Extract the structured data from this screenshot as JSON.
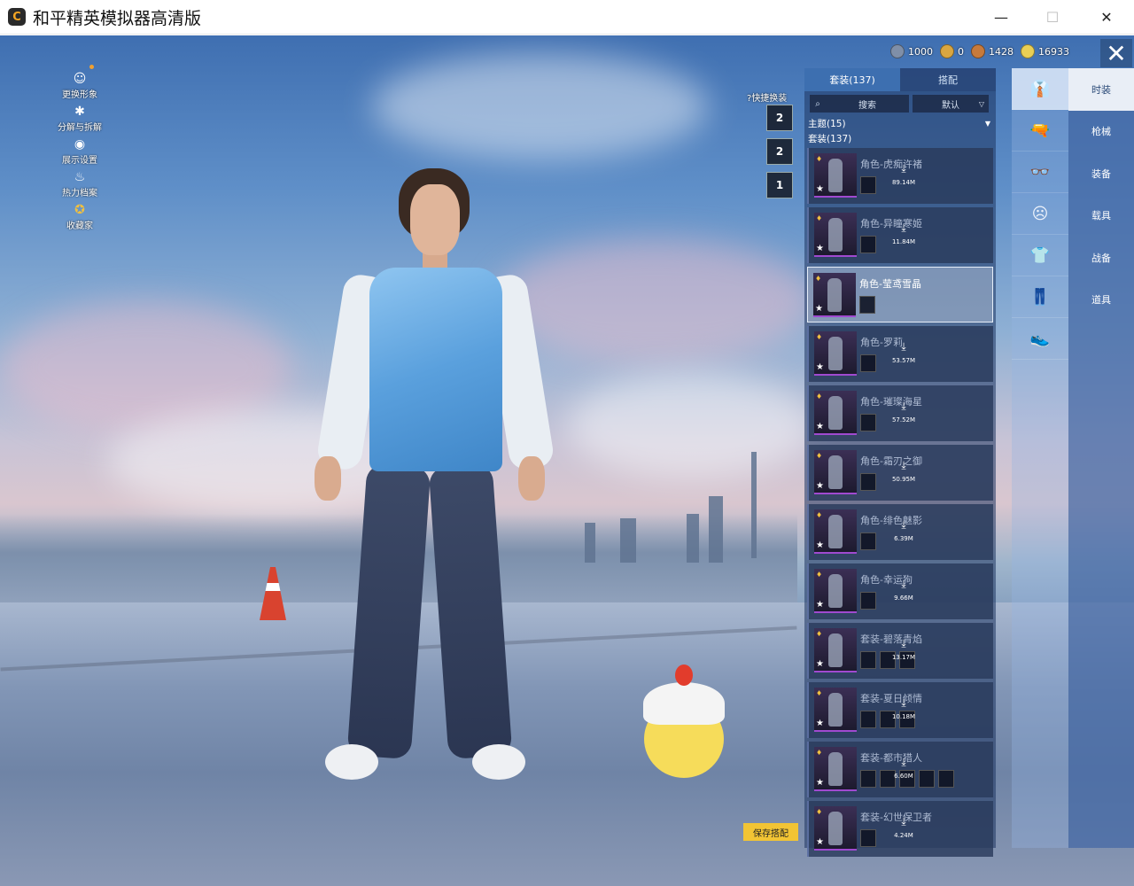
{
  "window": {
    "title": "和平精英模拟器高清版",
    "minimize_glyph": "—",
    "maximize_glyph": "☐",
    "close_glyph": "✕"
  },
  "left_menu": [
    {
      "label": "更换形象",
      "icon": "avatar-icon",
      "glyph": "☺"
    },
    {
      "label": "分解与拆解",
      "icon": "puzzle-icon",
      "glyph": "✱"
    },
    {
      "label": "展示设置",
      "icon": "eye-icon",
      "glyph": "◉"
    },
    {
      "label": "热力档案",
      "icon": "flame-icon",
      "glyph": "♨"
    },
    {
      "label": "收藏家",
      "icon": "collector-badge-icon",
      "glyph": "✪"
    }
  ],
  "currencies": [
    {
      "value": "1000",
      "color": "#7f8fa8"
    },
    {
      "value": "0",
      "color": "#d9a640"
    },
    {
      "value": "1428",
      "color": "#c67a3c"
    },
    {
      "value": "16933",
      "color": "#e9cf55"
    }
  ],
  "close_glyph": "✕",
  "quick_change": {
    "label": "快捷换装",
    "help_glyph": "?",
    "slots": [
      "2",
      "2",
      "1"
    ]
  },
  "wardrobe": {
    "tabs": [
      {
        "label": "套装(137)",
        "active": true
      },
      {
        "label": "搭配",
        "active": false
      }
    ],
    "search_placeholder": "搜索",
    "search_glyph": "⌕",
    "sort": "默认",
    "sort_chev": "▽",
    "section_theme": "主题(15)",
    "section_theme_arrow": "▼",
    "section_suits": "套装(137)",
    "items": [
      {
        "name": "角色-虎痴许褚",
        "size": "89.14M",
        "download": true,
        "selected": false,
        "subs": 1
      },
      {
        "name": "角色-异瞳寒姬",
        "size": "11.84M",
        "download": true,
        "selected": false,
        "subs": 1
      },
      {
        "name": "角色-莹鸢雪晶",
        "size": "",
        "download": false,
        "selected": true,
        "subs": 1
      },
      {
        "name": "角色-罗莉",
        "size": "53.57M",
        "download": true,
        "selected": false,
        "subs": 1
      },
      {
        "name": "角色-璀璨海星",
        "size": "57.52M",
        "download": true,
        "selected": false,
        "subs": 1
      },
      {
        "name": "角色-霜刃之御",
        "size": "50.95M",
        "download": true,
        "selected": false,
        "subs": 1
      },
      {
        "name": "角色-绯色魅影",
        "size": "6.39M",
        "download": true,
        "selected": false,
        "subs": 1
      },
      {
        "name": "角色-幸运狗",
        "size": "9.66M",
        "download": true,
        "selected": false,
        "subs": 1
      },
      {
        "name": "套装-碧落青焰",
        "size": "13.17M",
        "download": true,
        "selected": false,
        "subs": 3
      },
      {
        "name": "套装-夏日倾情",
        "size": "10.18M",
        "download": true,
        "selected": false,
        "subs": 3
      },
      {
        "name": "套装-都市猎人",
        "size": "6.60M",
        "download": true,
        "selected": false,
        "subs": 5
      },
      {
        "name": "套装-幻世保卫者",
        "size": "4.24M",
        "download": true,
        "selected": false,
        "subs": 1
      }
    ],
    "download_glyph": "⤓",
    "star_glyph": "★",
    "badge_glyph": "♦"
  },
  "save_button": "保存搭配",
  "categories": [
    {
      "label": "时装",
      "icon": "outfit-icon",
      "glyph": "👔",
      "active": true
    },
    {
      "label": "枪械",
      "icon": "gun-icon",
      "glyph": "🔫",
      "active": false
    },
    {
      "label": "装备",
      "icon": "goggles-icon",
      "glyph": "👓",
      "active": false
    },
    {
      "label": "载具",
      "icon": "mask-icon",
      "glyph": "☹",
      "active": false
    },
    {
      "label": "战备",
      "icon": "shirt-icon",
      "glyph": "👕",
      "active": false
    },
    {
      "label": "道具",
      "icon": "pants-icon",
      "glyph": "👖",
      "active": false
    },
    {
      "label": "",
      "icon": "shoes-icon",
      "glyph": "👟",
      "active": false
    }
  ]
}
